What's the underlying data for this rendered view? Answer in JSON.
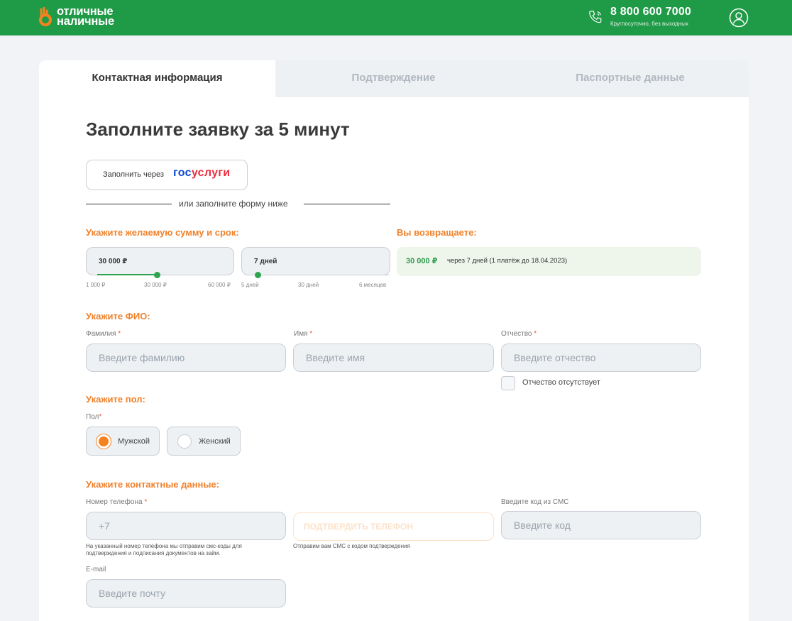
{
  "header": {
    "logo_line1": "отличные",
    "logo_line2": "наличные",
    "phone": "8 800 600 7000",
    "phone_sub": "Круглосуточно, без выходных",
    "brand_color": "#1f9a46"
  },
  "tabs": [
    {
      "label": "Контактная информация",
      "active": true
    },
    {
      "label": "Подтверждение",
      "active": false
    },
    {
      "label": "Паспортные данные",
      "active": false
    }
  ],
  "form": {
    "title": "Заполните заявку за 5 минут",
    "gosuslugi_prefix": "Заполнить через",
    "gosuslugi_logo_a": "гос",
    "gosuslugi_logo_b": "услуги",
    "or_text": "или заполните форму ниже",
    "amount_section": "Укажите желаемую сумму и срок:",
    "amount": {
      "value": "30 000 ₽",
      "fraction": 0.47,
      "ticks": [
        "1 000 ₽",
        "30 000 ₽",
        "60 000 ₽"
      ]
    },
    "term": {
      "value": "7 дней",
      "fraction": 0.0,
      "ticks": [
        "5 дней",
        "30 дней",
        "6 месяцев"
      ]
    },
    "return_section": "Вы возвращаете:",
    "return_sum": "30 000 ₽",
    "return_note": "через 7 дней (1 платёж до 18.04.2023)",
    "fio_section": "Укажите ФИО:",
    "lastname_label": "Фамилия",
    "lastname_placeholder": "Введите фамилию",
    "firstname_label": "Имя",
    "firstname_placeholder": "Введите имя",
    "middlename_label": "Отчество",
    "middlename_placeholder": "Введите отчество",
    "no_middlename": "Отчество отсутствует",
    "gender_section": "Укажите пол:",
    "gender_label": "Пол",
    "gender_male": "Мужской",
    "gender_female": "Женский",
    "gender_selected": "Мужской",
    "contact_section": "Укажите контактные данные:",
    "phone_label": "Номер телефона",
    "phone_placeholder": "+7",
    "phone_hint_1": "На указанный номер телефона мы отправим смс-коды для",
    "phone_hint_2": "подтверждения и подписания документов на займ.",
    "confirm_button": "ПОДТВЕРДИТЬ ТЕЛЕФОН",
    "confirm_hint": "Отправим вам СМС с кодом подтверждения",
    "sms_label": "Введите код из СМС",
    "sms_placeholder": "Введите код",
    "email_label": "E-mail",
    "email_placeholder": "Введите почту",
    "required_mark": "*",
    "accent_color": "#f0812b"
  }
}
